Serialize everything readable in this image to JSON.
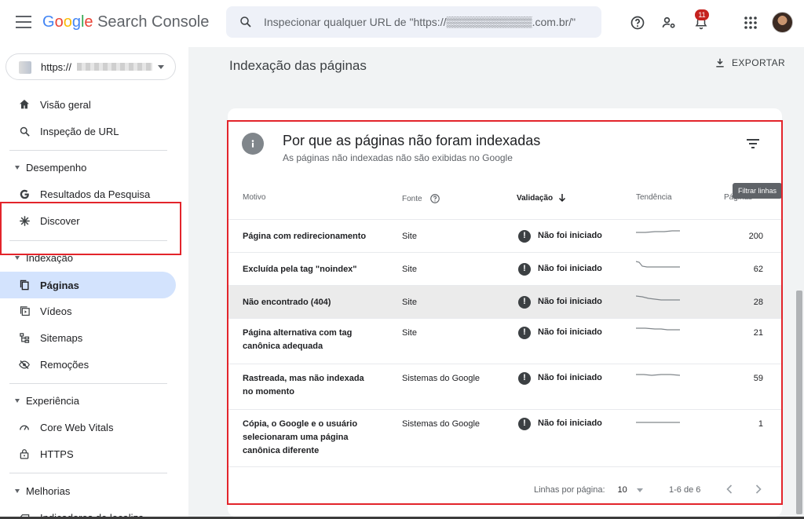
{
  "header": {
    "brand_letters": [
      "G",
      "o",
      "o",
      "g",
      "l",
      "e"
    ],
    "brand_suffix": " Search Console",
    "search_placeholder": "Inspecionar qualquer URL de \"https://▒▒▒▒▒▒▒▒▒▒▒.com.br/\"",
    "notification_count": "11",
    "icons": [
      "menu-icon",
      "search-icon",
      "help-icon",
      "manage-users-icon",
      "notifications-icon",
      "apps-icon",
      "account-avatar"
    ]
  },
  "sidebar": {
    "property_url": "https://",
    "items": [
      {
        "label": "Visão geral",
        "icon": "home-icon"
      },
      {
        "label": "Inspeção de URL",
        "icon": "search-icon"
      }
    ],
    "sections": [
      {
        "label": "Desempenho",
        "items": [
          {
            "label": "Resultados da Pesquisa",
            "icon": "google-g-icon"
          },
          {
            "label": "Discover",
            "icon": "asterisk-icon"
          }
        ]
      },
      {
        "label": "Indexação",
        "items": [
          {
            "label": "Páginas",
            "icon": "pages-icon",
            "active": true
          },
          {
            "label": "Vídeos",
            "icon": "video-icon"
          },
          {
            "label": "Sitemaps",
            "icon": "sitemap-icon"
          },
          {
            "label": "Remoções",
            "icon": "eye-off-icon"
          }
        ]
      },
      {
        "label": "Experiência",
        "items": [
          {
            "label": "Core Web Vitals",
            "icon": "gauge-icon"
          },
          {
            "label": "HTTPS",
            "icon": "lock-icon"
          }
        ]
      },
      {
        "label": "Melhorias",
        "items": [
          {
            "label": "Indicadores de localiza",
            "icon": "breadcrumb-icon"
          }
        ]
      }
    ]
  },
  "main": {
    "page_title": "Indexação das páginas",
    "export_label": "EXPORTAR",
    "card": {
      "title": "Por que as páginas não foram indexadas",
      "subtitle": "As páginas não indexadas não são exibidas no Google",
      "filter_tooltip": "Filtrar linhas",
      "columns": {
        "reason": "Motivo",
        "source": "Fonte",
        "validation": "Validação",
        "trend": "Tendência",
        "pages": "Páginas"
      },
      "rows": [
        {
          "reason": [
            "Página com redirecionamento"
          ],
          "source": "Site",
          "validation": "Não foi iniciado",
          "pages": "200"
        },
        {
          "reason": [
            "Excluída pela tag \"noindex\""
          ],
          "source": "Site",
          "validation": "Não foi iniciado",
          "pages": "62"
        },
        {
          "reason": [
            "Não encontrado (404)"
          ],
          "source": "Site",
          "validation": "Não foi iniciado",
          "pages": "28"
        },
        {
          "reason": [
            "Página alternativa com tag",
            "canônica adequada"
          ],
          "source": "Site",
          "validation": "Não foi iniciado",
          "pages": "21"
        },
        {
          "reason": [
            "Rastreada, mas não indexada",
            "no momento"
          ],
          "source": "Sistemas do Google",
          "validation": "Não foi iniciado",
          "pages": "59"
        },
        {
          "reason": [
            "Cópia, o Google e o usuário",
            "selecionaram uma página",
            "canônica diferente"
          ],
          "source": "Sistemas do Google",
          "validation": "Não foi iniciado",
          "pages": "1"
        }
      ],
      "pagination": {
        "rows_per_page_label": "Linhas por página:",
        "rows_per_page": "10",
        "range": "1-6 de 6"
      }
    }
  },
  "colors": {
    "accent_active": "#d3e3fd",
    "highlight_border": "#e3242b",
    "badge": "#c5221f"
  }
}
